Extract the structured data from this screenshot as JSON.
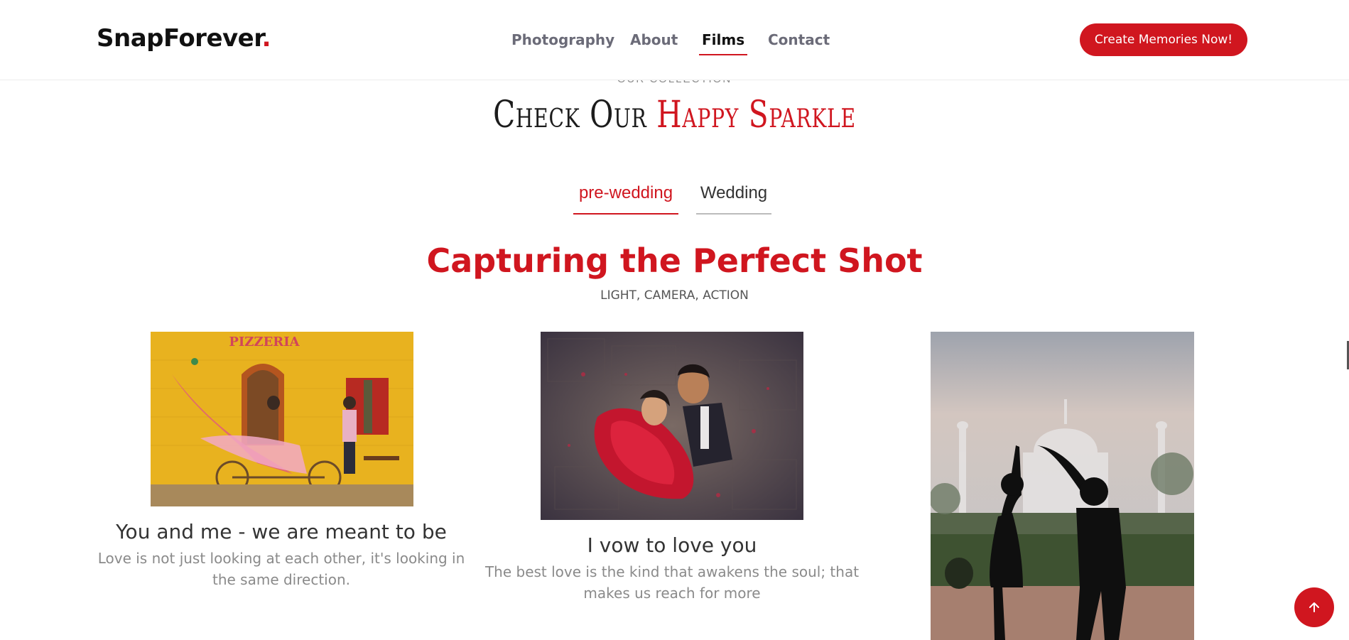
{
  "header": {
    "logo_text": "SnapForever",
    "logo_dot": ".",
    "nav": [
      "Photography",
      "About",
      "Films",
      "Contact"
    ],
    "active_nav": "Films",
    "cta_label": "Create Memories Now!"
  },
  "section": {
    "eyebrow": "Our Collection",
    "title_plain": "Check Our ",
    "title_accent": "Happy Sparkle",
    "tabs": [
      "pre-wedding",
      "Wedding"
    ],
    "active_tab": "pre-wedding",
    "heading": "Capturing the Perfect Shot",
    "subheading": "LIGHT, CAMERA, ACTION"
  },
  "cards": [
    {
      "title": "You and me - we are meant to be",
      "text": "Love is not just looking at each other, it's looking in the same direction.",
      "image_sign": "PIZZERIA"
    },
    {
      "title": "I vow to love you",
      "text": "The best love is the kind that awakens the soul; that makes us reach for more"
    },
    {
      "title": "",
      "text": ""
    }
  ],
  "colors": {
    "accent": "#d0161f",
    "text_dark": "#111111",
    "text_muted": "#8a8a8a"
  },
  "icons": {
    "back_to_top": "arrow-up-icon"
  }
}
